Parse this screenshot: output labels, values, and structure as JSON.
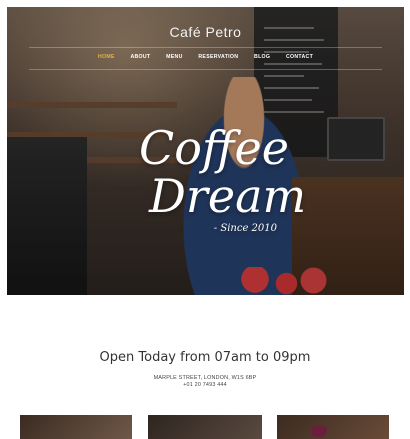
{
  "brand": {
    "name": "Café Petro"
  },
  "nav": {
    "items": [
      {
        "label": "HOME",
        "active": true
      },
      {
        "label": "ABOUT",
        "active": false
      },
      {
        "label": "MENU",
        "active": false
      },
      {
        "label": "RESERVATION",
        "active": false
      },
      {
        "label": "BLOG",
        "active": false
      },
      {
        "label": "CONTACT",
        "active": false
      }
    ]
  },
  "hero": {
    "title_line1": "Coffee",
    "title_line2": "Dream",
    "since": "- Since 2010"
  },
  "info": {
    "hours": "Open Today from 07am to 09pm",
    "address_line1": "MARPLE STREET, LONDON, W1S 6BP",
    "phone": "+01 20 7493 444"
  },
  "colors": {
    "accent": "#e3b343",
    "hero_text": "#ffffff"
  }
}
